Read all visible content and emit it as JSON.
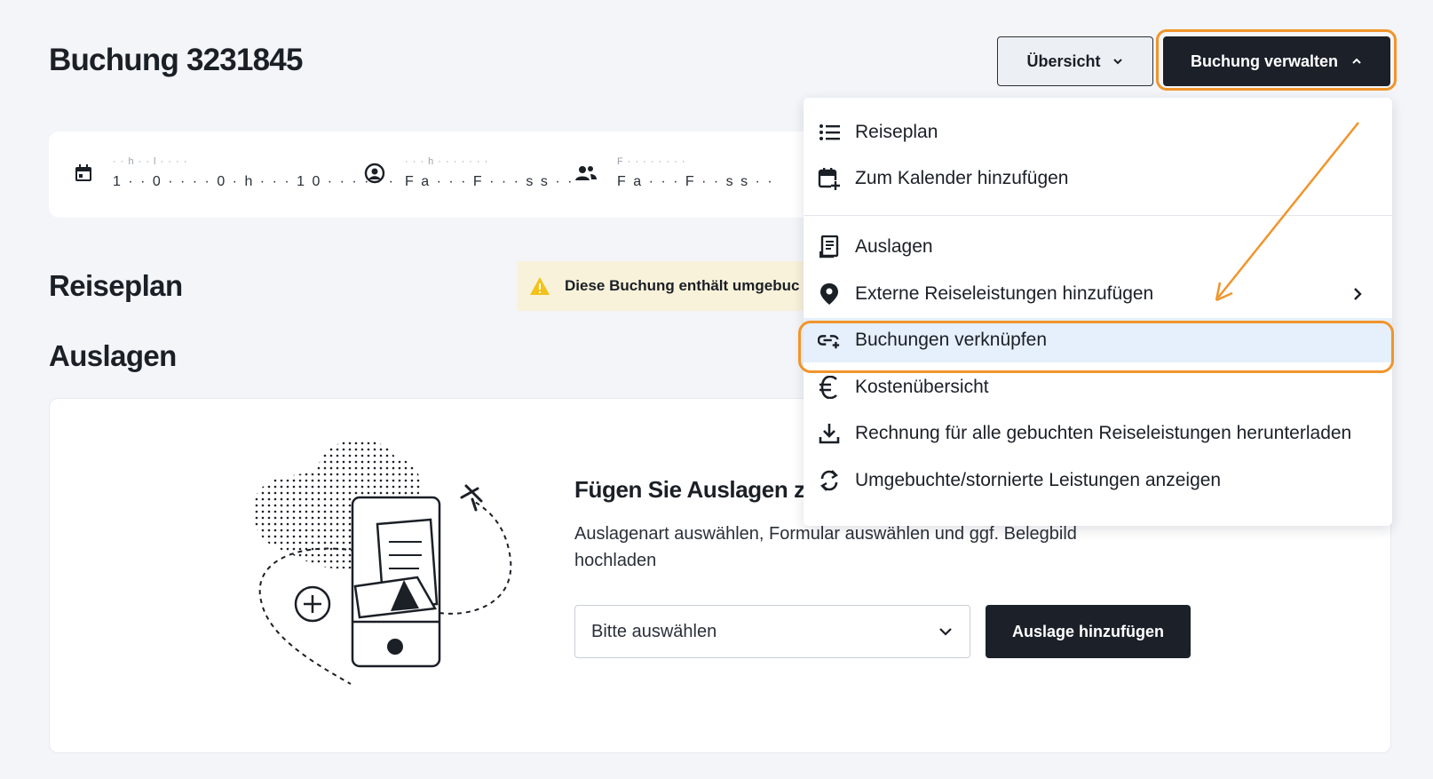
{
  "header": {
    "title": "Buchung 3231845",
    "overview_label": "Übersicht",
    "manage_label": "Buchung verwalten"
  },
  "info_card": {
    "items": [
      {
        "label": "· · h · · l · · · ·",
        "value": "1 · · 0 · · · · 0 · h · · · 1 0 · · · · · ·",
        "icon": "calendar-icon"
      },
      {
        "label": "· · · h · · · · · · ·",
        "value": "F a · · · F · · · s s · ·",
        "icon": "user-circle-icon"
      },
      {
        "label": "F · · · · · · · ·",
        "value": "F a · · · F · · s s · ·",
        "icon": "travelers-icon"
      }
    ]
  },
  "sections": {
    "itinerary_title": "Reiseplan",
    "expenses_title": "Auslagen"
  },
  "warning": {
    "text": "Diese Buchung enthält umgebuc"
  },
  "expenses": {
    "heading": "Fügen Sie Auslagen z",
    "description": "Auslagenart auswählen, Formular auswählen und ggf. Belegbild hochladen",
    "select_placeholder": "Bitte auswählen",
    "add_button": "Auslage hinzufügen"
  },
  "menu": {
    "items": [
      {
        "label": "Reiseplan",
        "icon": "list-icon"
      },
      {
        "label": "Zum Kalender hinzufügen",
        "icon": "calendar-add-icon"
      },
      {
        "label": "Auslagen",
        "icon": "receipt-icon"
      },
      {
        "label": "Externe Reiseleistungen hinzufügen",
        "icon": "location-pin-icon",
        "has_submenu": true
      },
      {
        "label": "Buchungen verknüpfen",
        "icon": "link-add-icon",
        "active": true
      },
      {
        "label": "Kostenübersicht",
        "icon": "euro-icon"
      },
      {
        "label": "Rechnung für alle gebuchten Reiseleistungen herunterladen",
        "icon": "download-icon"
      },
      {
        "label": "Umgebuchte/stornierte Leistungen anzeigen",
        "icon": "refresh-icon"
      }
    ]
  },
  "colors": {
    "accent_highlight": "#f0952b",
    "primary_dark": "#1b2029",
    "active_item_bg": "#e6f0fc",
    "warning_bg": "#f8f2da"
  }
}
